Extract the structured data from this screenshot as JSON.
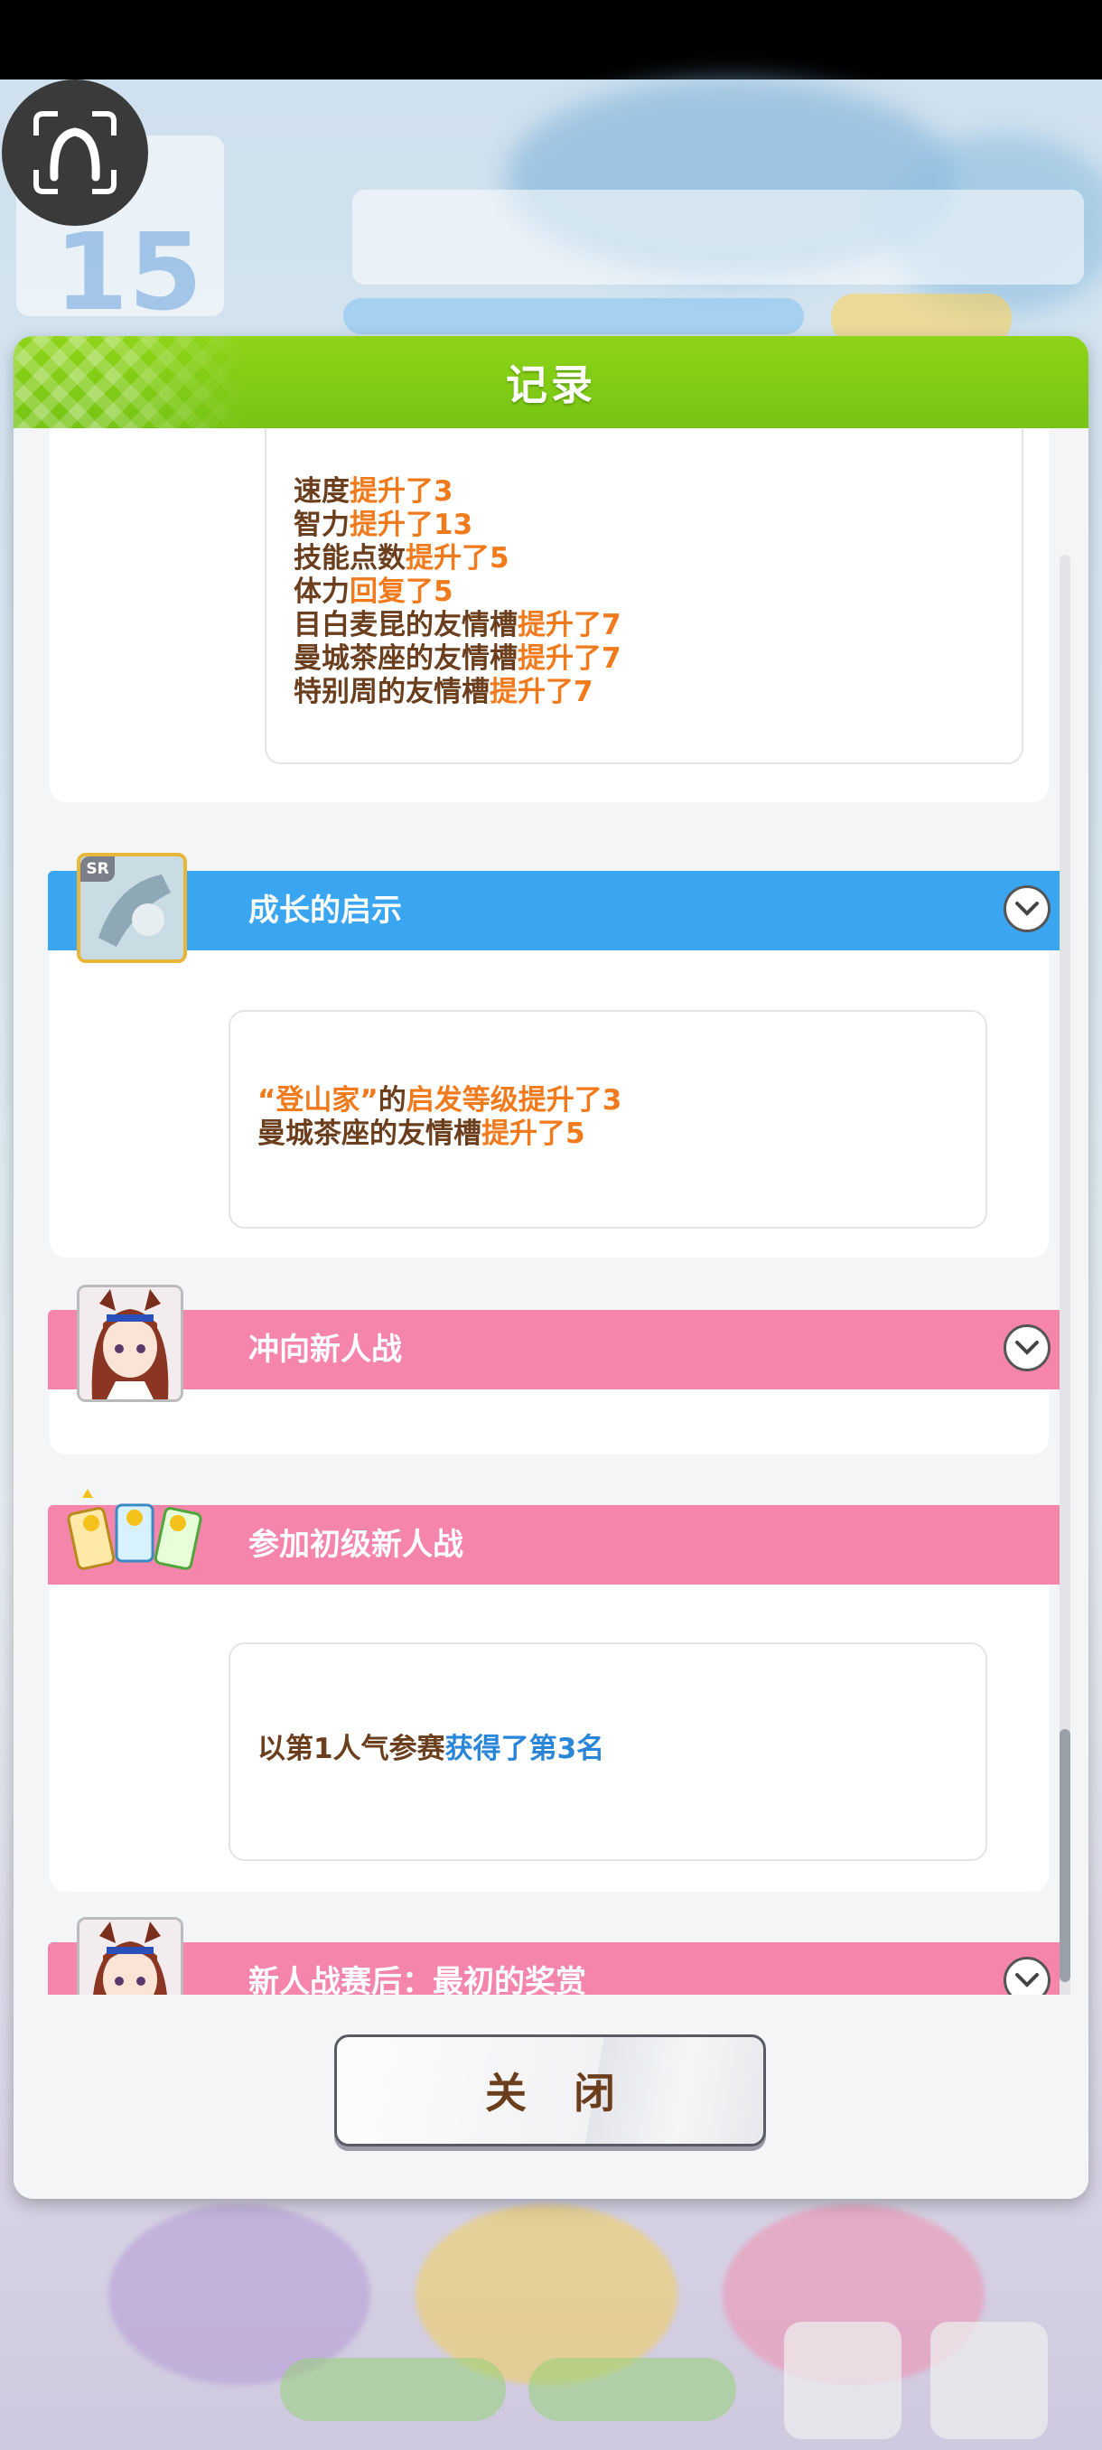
{
  "dialog": {
    "title": "记录",
    "close_label": "关 闭"
  },
  "events": [
    {
      "title": "",
      "lines": [
        {
          "a": "速度",
          "b": "提升了3"
        },
        {
          "a": "智力",
          "b": "提升了13"
        },
        {
          "a": "技能点数",
          "b": "提升了5"
        },
        {
          "a": "体力",
          "b": "回复了5"
        },
        {
          "a": "目白麦昆的友情槽",
          "b": "提升了7"
        },
        {
          "a": "曼城茶座的友情槽",
          "b": "提升了7"
        },
        {
          "a": "特别周的友情槽",
          "b": "提升了7"
        }
      ]
    },
    {
      "title": "成长的启示",
      "badge": "SR",
      "lines": [
        {
          "q": "“登山家”",
          "a": "的",
          "b": "启发等级提升了3"
        },
        {
          "a": "曼城茶座的友情槽",
          "b": "提升了5"
        }
      ]
    },
    {
      "title": "冲向新人战"
    },
    {
      "title": "参加初级新人战",
      "lines": [
        {
          "a": "以第1人气参赛",
          "b": "获得了第3名"
        }
      ]
    },
    {
      "title": "新人战赛后：最初的奖赏"
    }
  ],
  "colors": {
    "header_green": "#7ccb15",
    "bar_blue": "#3aa6f2",
    "bar_pink": "#f585ab",
    "text_brown": "#6b3f1d",
    "highlight_orange": "#f07a1c",
    "highlight_blue": "#2a86d8"
  },
  "icons": [
    "camera-face-icon",
    "chevron-down-icon",
    "support-card-thumbnail",
    "horse-girl-avatar",
    "race-cards-icon"
  ]
}
